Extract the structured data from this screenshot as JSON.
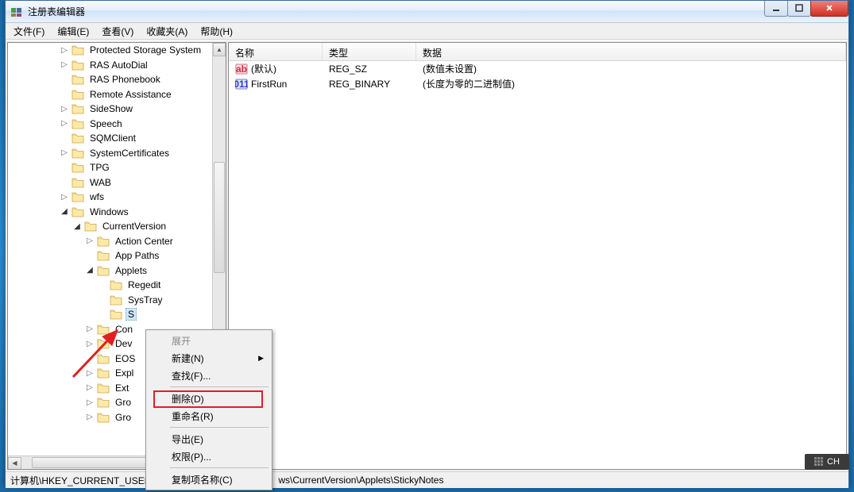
{
  "title": "注册表编辑器",
  "menus": {
    "file": "文件(F)",
    "edit": "编辑(E)",
    "view": "查看(V)",
    "fav": "收藏夹(A)",
    "help": "帮助(H)"
  },
  "tree": {
    "items": [
      {
        "d": 4,
        "e": ">",
        "n": "Protected Storage System"
      },
      {
        "d": 4,
        "e": ">",
        "n": "RAS AutoDial"
      },
      {
        "d": 4,
        "e": "",
        "n": "RAS Phonebook"
      },
      {
        "d": 4,
        "e": "",
        "n": "Remote Assistance"
      },
      {
        "d": 4,
        "e": ">",
        "n": "SideShow"
      },
      {
        "d": 4,
        "e": ">",
        "n": "Speech"
      },
      {
        "d": 4,
        "e": "",
        "n": "SQMClient"
      },
      {
        "d": 4,
        "e": ">",
        "n": "SystemCertificates"
      },
      {
        "d": 4,
        "e": "",
        "n": "TPG"
      },
      {
        "d": 4,
        "e": "",
        "n": "WAB"
      },
      {
        "d": 4,
        "e": ">",
        "n": "wfs"
      },
      {
        "d": 4,
        "e": "v",
        "n": "Windows"
      },
      {
        "d": 5,
        "e": "v",
        "n": "CurrentVersion"
      },
      {
        "d": 6,
        "e": ">",
        "n": "Action Center"
      },
      {
        "d": 6,
        "e": "",
        "n": "App Paths"
      },
      {
        "d": 6,
        "e": "v",
        "n": "Applets"
      },
      {
        "d": 7,
        "e": "",
        "n": "Regedit"
      },
      {
        "d": 7,
        "e": "",
        "n": "SysTray"
      },
      {
        "d": 7,
        "e": "",
        "n": "S",
        "sel": true
      },
      {
        "d": 6,
        "e": ">",
        "n": "Con"
      },
      {
        "d": 6,
        "e": ">",
        "n": "Dev"
      },
      {
        "d": 6,
        "e": "",
        "n": "EOS"
      },
      {
        "d": 6,
        "e": ">",
        "n": "Expl"
      },
      {
        "d": 6,
        "e": ">",
        "n": "Ext"
      },
      {
        "d": 6,
        "e": ">",
        "n": "Gro"
      },
      {
        "d": 6,
        "e": ">",
        "n": "Gro"
      }
    ]
  },
  "list": {
    "cols": {
      "name": "名称",
      "type": "类型",
      "data": "数据"
    },
    "rows": [
      {
        "icon": "str",
        "name": "(默认)",
        "type": "REG_SZ",
        "data": "(数值未设置)"
      },
      {
        "icon": "bin",
        "name": "FirstRun",
        "type": "REG_BINARY",
        "data": "(长度为零的二进制值)"
      }
    ]
  },
  "ctx": {
    "expand": "展开",
    "new": "新建(N)",
    "find": "查找(F)...",
    "delete": "删除(D)",
    "rename": "重命名(R)",
    "export": "导出(E)",
    "perm": "权限(P)...",
    "copykey": "复制项名称(C)"
  },
  "status_prefix": "计算机\\HKEY_CURRENT_USER",
  "status_suffix": "ws\\CurrentVersion\\Applets\\StickyNotes",
  "ime": "CH"
}
